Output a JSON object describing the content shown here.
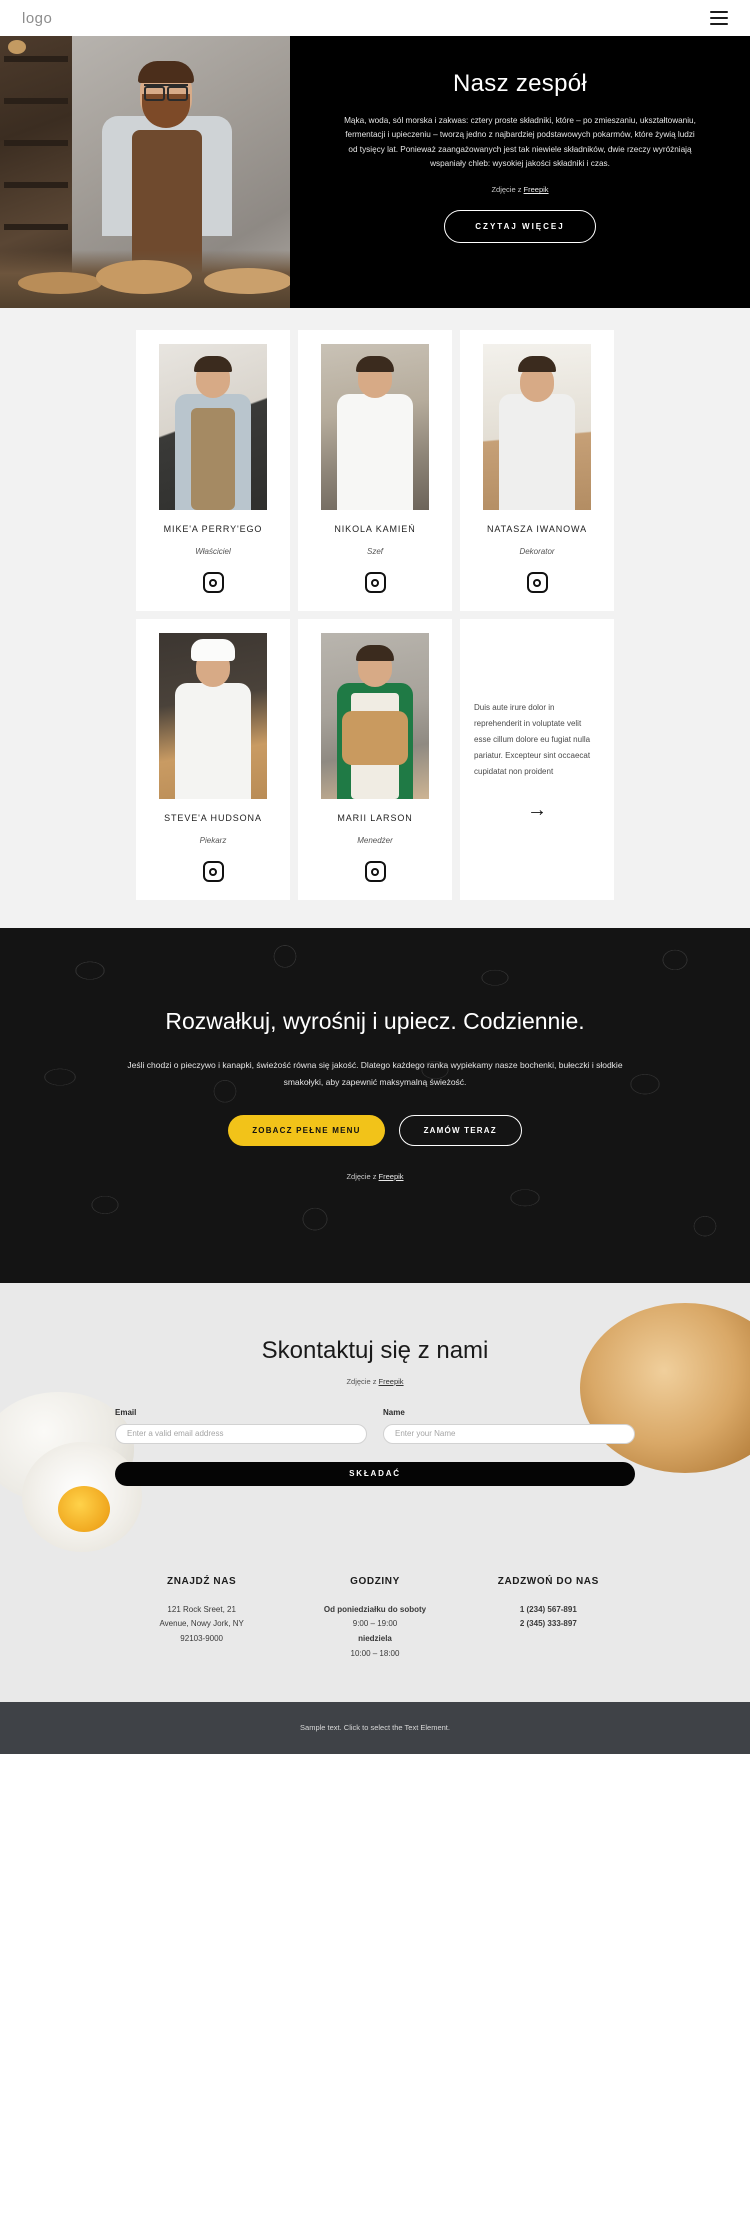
{
  "header": {
    "logo": "logo",
    "menu_icon": "hamburger-icon"
  },
  "hero": {
    "title": "Nasz zespół",
    "body": "Mąka, woda, sól morska i zakwas: cztery proste składniki, które – po zmieszaniu, ukształtowaniu, fermentacji i upieczeniu – tworzą jedno z najbardziej podstawowych pokarmów, które żywią ludzi od tysięcy lat. Ponieważ zaangażowanych jest tak niewiele składników, dwie rzeczy wyróżniają wspaniały chleb: wysokiej jakości składniki i czas.",
    "credit_prefix": "Zdjęcie z ",
    "credit_link": "Freepik",
    "button": "CZYTAJ WIĘCEJ"
  },
  "team": [
    {
      "name": "MIKE'A PERRY'EGO",
      "role": "Właściciel",
      "social": "instagram-icon"
    },
    {
      "name": "NIKOLA KAMIEŃ",
      "role": "Szef",
      "social": "instagram-icon"
    },
    {
      "name": "NATASZA IWANOWA",
      "role": "Dekorator",
      "social": "instagram-icon"
    },
    {
      "name": "STEVE'A HUDSONA",
      "role": "Piekarz",
      "social": "instagram-icon"
    },
    {
      "name": "MARII LARSON",
      "role": "Menedżer",
      "social": "instagram-icon"
    }
  ],
  "team_text_card": {
    "text": "Duis aute irure dolor in reprehenderit in voluptate velit esse cillum dolore eu fugiat nulla pariatur. Excepteur sint occaecat cupidatat non proident",
    "arrow": "→"
  },
  "cta": {
    "title": "Rozwałkuj, wyrośnij i upiecz. Codziennie.",
    "body": "Jeśli chodzi o pieczywo i kanapki, świeżość równa się jakość. Dlatego każdego ranka wypiekamy nasze bochenki, bułeczki i słodkie smakołyki, aby zapewnić maksymalną świeżość.",
    "primary_button": "ZOBACZ PEŁNE MENU",
    "secondary_button": "ZAMÓW TERAZ",
    "credit_prefix": "Zdjęcie z ",
    "credit_link": "Freepik",
    "accent_color": "#f2c319",
    "background_color": "#141414"
  },
  "contact": {
    "title": "Skontaktuj się z nami",
    "credit_prefix": "Zdjęcie z ",
    "credit_link": "Freepik",
    "email_label": "Email",
    "email_placeholder": "Enter a valid email address",
    "email_value": "",
    "name_label": "Name",
    "name_placeholder": "Enter your Name",
    "name_value": "",
    "submit_label": "SKŁADAĆ"
  },
  "info": {
    "find_us": {
      "title": "ZNAJDŹ NAS",
      "line1": "121 Rock Sreet, 21",
      "line2": "Avenue, Nowy Jork, NY",
      "line3": "92103-9000"
    },
    "hours": {
      "title": "GODZINY",
      "line1": "Od poniedziałku do soboty",
      "line2": "9:00 – 19:00",
      "line3": "niedziela",
      "line4": "10:00 – 18:00"
    },
    "call_us": {
      "title": "ZADZWOŃ DO NAS",
      "line1": "1 (234) 567-891",
      "line2": "2 (345) 333-897"
    }
  },
  "footer": {
    "text": "Sample text. Click to select the Text Element."
  }
}
